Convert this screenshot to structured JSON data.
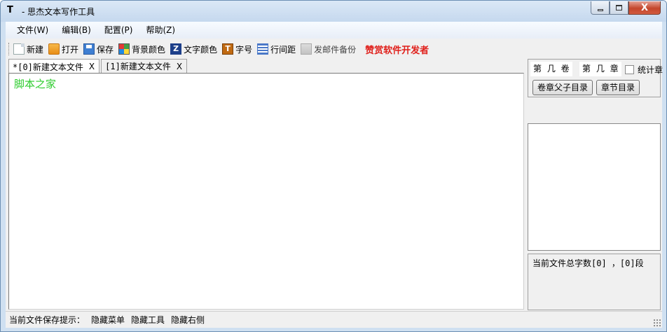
{
  "window": {
    "title": "- 思杰文本写作工具",
    "icon": "T",
    "close_label": "X"
  },
  "menu": [
    "文件(W)",
    "编辑(B)",
    "配置(P)",
    "帮助(Z)"
  ],
  "toolbar": {
    "new": "新建",
    "open": "打开",
    "save": "保存",
    "bg_color": "背景颜色",
    "font_color": "文字颜色",
    "font_size": "字号",
    "line_spacing": "行间距",
    "mail_backup": "发邮件备份",
    "sponsor": "赞赏软件开发者",
    "font_color_glyph": "Z",
    "font_size_glyph": "T"
  },
  "tabs": [
    {
      "label": "*[0]新建文本文件",
      "close": "X",
      "active": true
    },
    {
      "label": "[1]新建文本文件",
      "close": "X",
      "active": false
    }
  ],
  "editor": {
    "content": "脚本之家",
    "text_color": "#2ecc2e"
  },
  "right_panel": {
    "volume_field": "第 几 卷",
    "chapter_field": "第 几 章",
    "stat_label": "统计章",
    "btn_volume_tree": "卷章父子目录",
    "btn_chapter_list": "章节目录",
    "count_text": "当前文件总字数[0] ，[0]段"
  },
  "statusbar": {
    "save_hint": "当前文件保存提示：",
    "hide_menu": "隐藏菜单",
    "hide_tools": "隐藏工具",
    "hide_right": "隐藏右侧"
  },
  "colors": {
    "sponsor": "#e0201b",
    "window_frame": "#cfe0f1",
    "close_button": "#c4462c"
  }
}
